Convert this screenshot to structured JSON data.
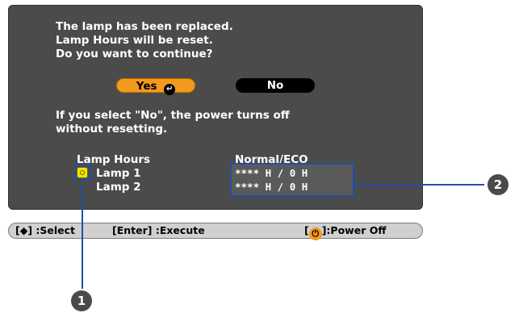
{
  "dialog": {
    "message_lines": [
      "The lamp has been replaced.",
      "Lamp Hours will be reset.",
      "Do you want to continue?"
    ],
    "yes_label": "Yes",
    "no_label": "No",
    "note_lines": [
      "If you select \"No\", the power turns off",
      "without resetting."
    ],
    "lamp_hours_label": "Lamp Hours",
    "mode_label": "Normal/ECO",
    "lamps": [
      {
        "label": "Lamp 1",
        "hours": "****  H /      0  H"
      },
      {
        "label": "Lamp 2",
        "hours": "****  H /      0  H"
      }
    ]
  },
  "hint_bar": {
    "select": "[◆] :Select",
    "execute": "[Enter] :Execute",
    "power_prefix": "[",
    "power_suffix": "]:Power Off"
  },
  "callouts": [
    "1",
    "2"
  ],
  "colors": {
    "osd_background": "#4b4b4b",
    "yes_button": "#f29a1d",
    "no_button": "#000000",
    "highlight": "#1f4fa8",
    "lamp_icon": "#f6e100"
  },
  "icons": [
    "enter-icon",
    "lamp-indicator-icon",
    "power-icon",
    "select-arrows-icon"
  ]
}
